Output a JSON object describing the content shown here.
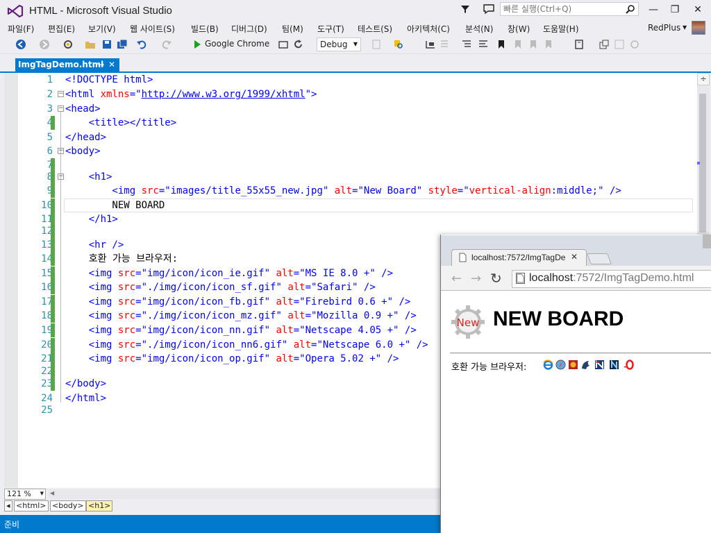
{
  "window": {
    "title": "HTML - Microsoft Visual Studio"
  },
  "quick_launch": {
    "placeholder": "빠른 실행(Ctrl+Q)"
  },
  "window_controls": {
    "minimize": "—",
    "restore": "❐",
    "close": "✕"
  },
  "menu": [
    "파일(F)",
    "편집(E)",
    "보기(V)",
    "웹 사이트(S)",
    "빌드(B)",
    "디버그(D)",
    "팀(M)",
    "도구(T)",
    "테스트(S)",
    "아키텍처(C)",
    "분석(N)",
    "창(W)",
    "도움말(H)"
  ],
  "user": {
    "name": "RedPlus"
  },
  "toolbar": {
    "run_target": "Google Chrome",
    "configuration": "Debug"
  },
  "document_tab": {
    "title": "ImgTagDemo.html",
    "pin": "⊸",
    "close": "✕"
  },
  "editor": {
    "lines": [
      {
        "n": "1"
      },
      {
        "n": "2"
      },
      {
        "n": "3"
      },
      {
        "n": "4"
      },
      {
        "n": "5"
      },
      {
        "n": "6"
      },
      {
        "n": "7"
      },
      {
        "n": "8"
      },
      {
        "n": "9"
      },
      {
        "n": "10"
      },
      {
        "n": "11"
      },
      {
        "n": "12"
      },
      {
        "n": "13"
      },
      {
        "n": "14"
      },
      {
        "n": "15"
      },
      {
        "n": "16"
      },
      {
        "n": "17"
      },
      {
        "n": "18"
      },
      {
        "n": "19"
      },
      {
        "n": "20"
      },
      {
        "n": "21"
      },
      {
        "n": "22"
      },
      {
        "n": "23"
      },
      {
        "n": "24"
      },
      {
        "n": "25"
      }
    ],
    "code": {
      "l1": "<!DOCTYPE html>",
      "l2a": "<html ",
      "l2b": "xmlns",
      "l2c": "=\"",
      "l2d": "http://www.w3.org/1999/xhtml",
      "l2e": "\">",
      "l3": "<head>",
      "l4": "    <title></title>",
      "l5": "</head>",
      "l6": "<body>",
      "l8": "    <h1>",
      "l9a": "        <img ",
      "l9b": "src",
      "l9c": "=\"images/title_55x55_new.jpg\" ",
      "l9d": "alt",
      "l9e": "=\"New Board\" ",
      "l9f": "style",
      "l9g": "=\"",
      "l9h": "vertical-align",
      "l9i": ":middle;\" />",
      "l10": "        NEW BOARD",
      "l11": "    </h1>",
      "l13": "    <hr />",
      "l14": "    호환 가능 브라우저:",
      "img_lines": [
        {
          "src": "=\"img/icon/icon_ie.gif\" ",
          "alt": "=\"MS IE 8.0 +\" />"
        },
        {
          "src": "=\"./img/icon/icon_sf.gif\" ",
          "alt": "=\"Safari\" />"
        },
        {
          "src": "=\"img/icon/icon_fb.gif\" ",
          "alt": "=\"Firebird 0.6 +\" />"
        },
        {
          "src": "=\"./img/icon/icon_mz.gif\" ",
          "alt": "=\"Mozilla 0.9 +\" />"
        },
        {
          "src": "=\"img/icon/icon_nn.gif\" ",
          "alt": "=\"Netscape 4.05 +\" />"
        },
        {
          "src": "=\"./img/icon/icon_nn6.gif\" ",
          "alt": "=\"Netscape 6.0 +\" />"
        },
        {
          "src": "=\"img/icon/icon_op.gif\" ",
          "alt": "=\"Opera 5.02 +\" />"
        }
      ],
      "img_tag": "    <img ",
      "src_attr": "src",
      "alt_attr": "alt",
      "l23": "</body>",
      "l24": "</html>"
    }
  },
  "zoom": "121 %",
  "breadcrumbs": [
    "<html>",
    "<body>",
    "<h1>"
  ],
  "status": {
    "text": "준비"
  },
  "browser": {
    "tab_title": "localhost:7572/ImgTagDe",
    "url_host": "localhost",
    "url_rest": ":7572/ImgTagDemo.html",
    "page": {
      "logo_text": "New",
      "heading": "NEW BOARD",
      "browsers_label": "호환 가능 브라우저:"
    }
  }
}
